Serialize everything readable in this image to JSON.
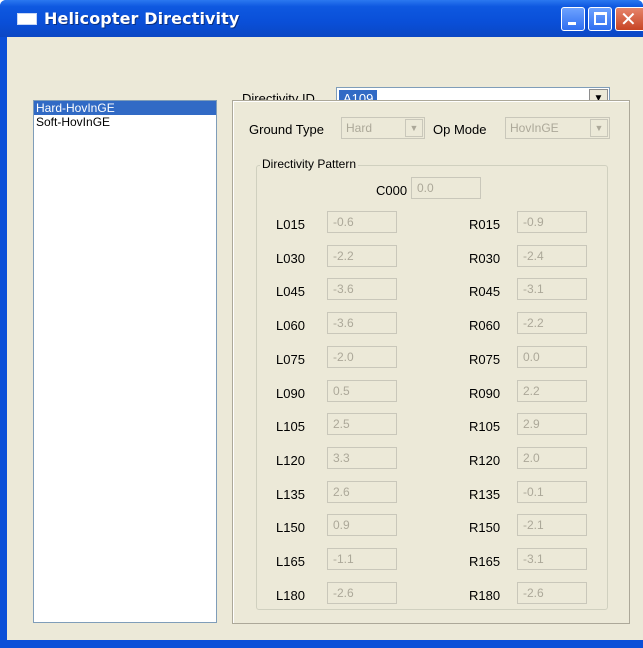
{
  "window": {
    "title": "Helicopter Directivity"
  },
  "header": {
    "directivity_label": "Directivity ID",
    "directivity_value": "A109"
  },
  "list": {
    "items": [
      "Hard-HovInGE",
      "Soft-HovInGE"
    ],
    "selected_index": 0
  },
  "controls": {
    "ground_type_label": "Ground Type",
    "ground_type_value": "Hard",
    "op_mode_label": "Op Mode",
    "op_mode_value": "HovInGE"
  },
  "pattern": {
    "title": "Directivity Pattern",
    "center": {
      "label": "C000",
      "value": "0.0"
    },
    "left": [
      {
        "label": "L015",
        "value": "-0.6"
      },
      {
        "label": "L030",
        "value": "-2.2"
      },
      {
        "label": "L045",
        "value": "-3.6"
      },
      {
        "label": "L060",
        "value": "-3.6"
      },
      {
        "label": "L075",
        "value": "-2.0"
      },
      {
        "label": "L090",
        "value": "0.5"
      },
      {
        "label": "L105",
        "value": "2.5"
      },
      {
        "label": "L120",
        "value": "3.3"
      },
      {
        "label": "L135",
        "value": "2.6"
      },
      {
        "label": "L150",
        "value": "0.9"
      },
      {
        "label": "L165",
        "value": "-1.1"
      },
      {
        "label": "L180",
        "value": "-2.6"
      }
    ],
    "right": [
      {
        "label": "R015",
        "value": "-0.9"
      },
      {
        "label": "R030",
        "value": "-2.4"
      },
      {
        "label": "R045",
        "value": "-3.1"
      },
      {
        "label": "R060",
        "value": "-2.2"
      },
      {
        "label": "R075",
        "value": "0.0"
      },
      {
        "label": "R090",
        "value": "2.2"
      },
      {
        "label": "R105",
        "value": "2.9"
      },
      {
        "label": "R120",
        "value": "2.0"
      },
      {
        "label": "R135",
        "value": "-0.1"
      },
      {
        "label": "R150",
        "value": "-2.1"
      },
      {
        "label": "R165",
        "value": "-3.1"
      },
      {
        "label": "R180",
        "value": "-2.6"
      }
    ]
  },
  "colors": {
    "titlebar": "#0a4fd8",
    "selection": "#316ac5",
    "face": "#ece9d8",
    "disabled_text": "#aca899"
  }
}
